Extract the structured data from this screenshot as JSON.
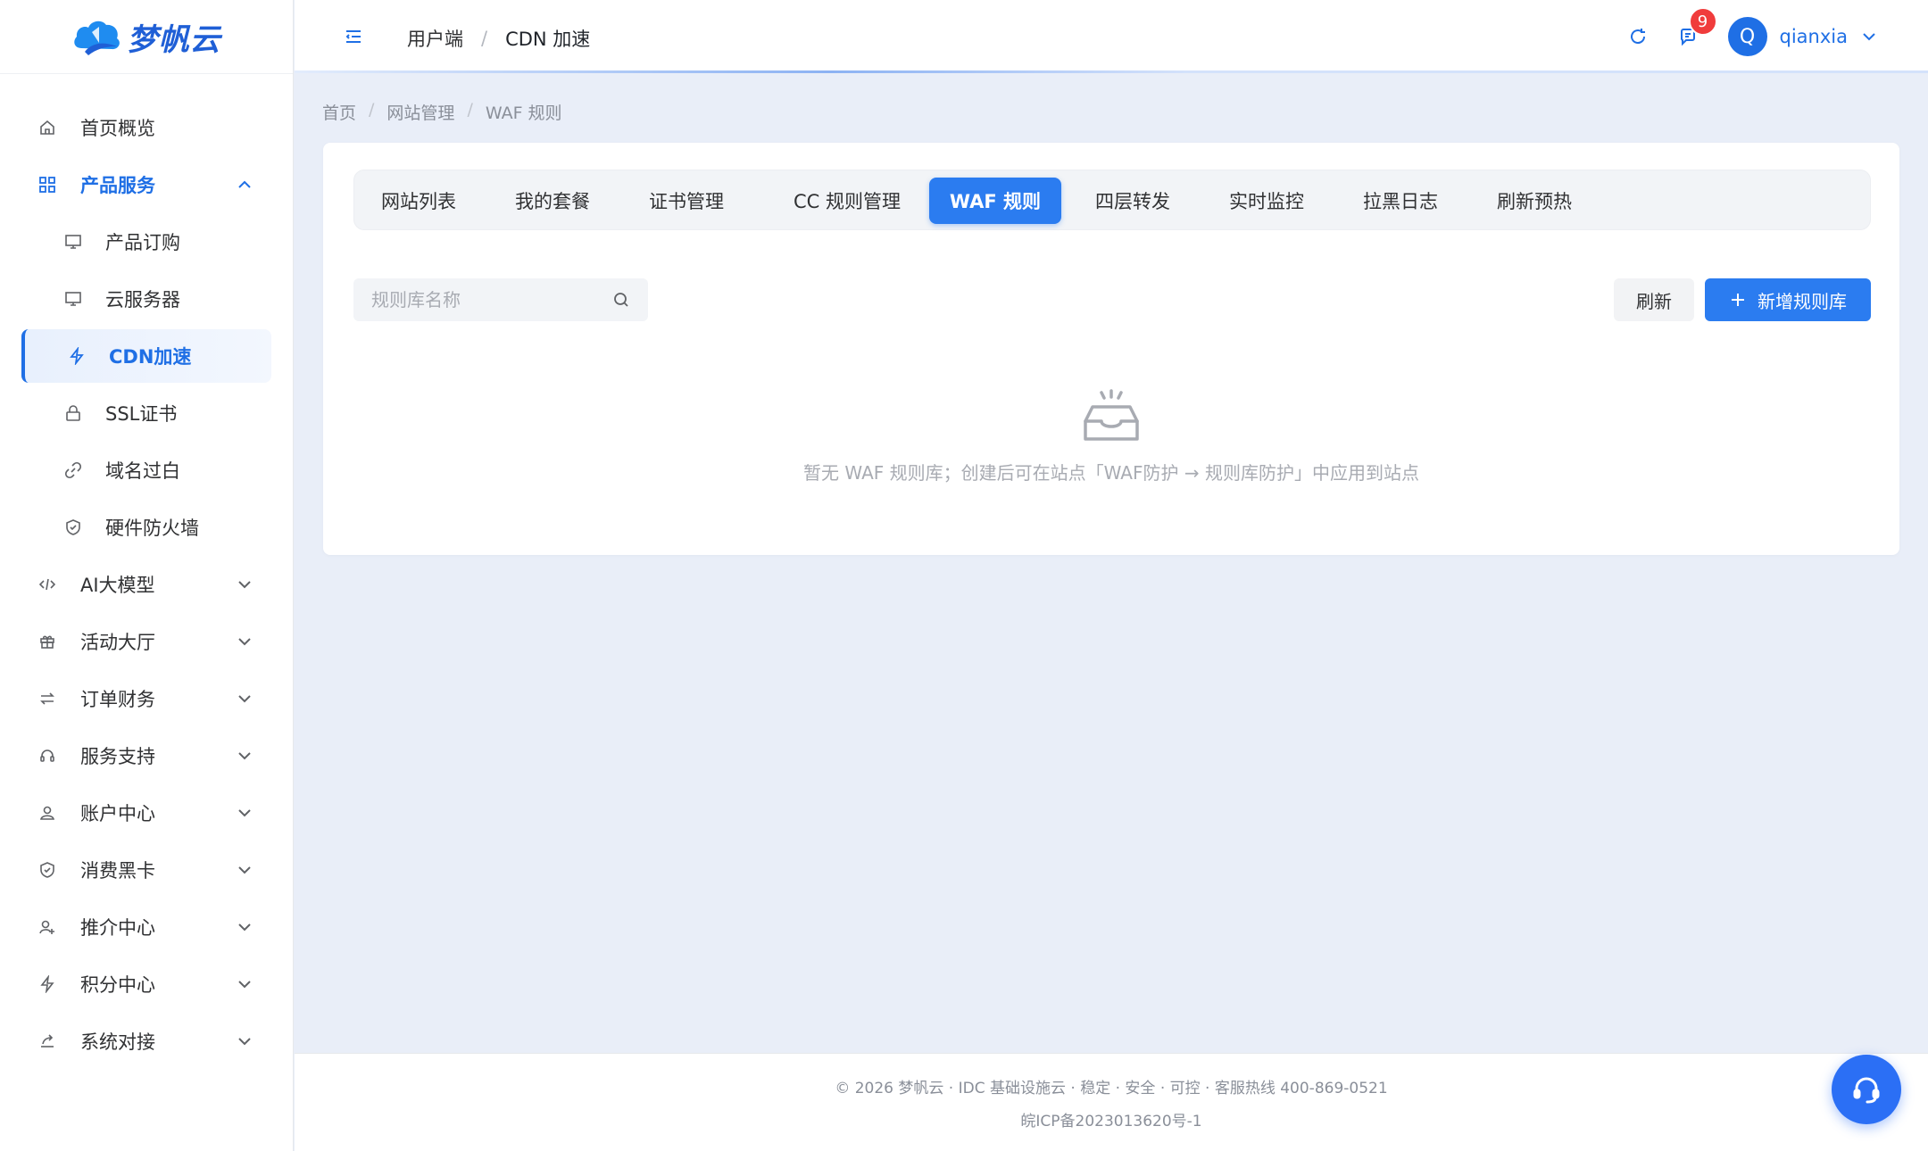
{
  "brand": {
    "name": "梦帆云",
    "color": "#1f5fd6"
  },
  "sidebar": {
    "items": [
      {
        "label": "首页概览",
        "icon": "home-icon"
      },
      {
        "label": "产品服务",
        "icon": "grid-icon",
        "expanded": true,
        "children": [
          {
            "label": "产品订购",
            "icon": "monitor-icon"
          },
          {
            "label": "云服务器",
            "icon": "monitor-icon"
          },
          {
            "label": "CDN加速",
            "icon": "bolt-icon",
            "active": true
          },
          {
            "label": "SSL证书",
            "icon": "lock-icon"
          },
          {
            "label": "域名过白",
            "icon": "link-icon"
          },
          {
            "label": "硬件防火墙",
            "icon": "shield-icon"
          }
        ]
      },
      {
        "label": "AI大模型",
        "icon": "code-icon"
      },
      {
        "label": "活动大厅",
        "icon": "gift-icon"
      },
      {
        "label": "订单财务",
        "icon": "swap-icon"
      },
      {
        "label": "服务支持",
        "icon": "headset-icon"
      },
      {
        "label": "账户中心",
        "icon": "user-icon"
      },
      {
        "label": "消费黑卡",
        "icon": "shield-icon"
      },
      {
        "label": "推介中心",
        "icon": "user-plus-icon"
      },
      {
        "label": "积分中心",
        "icon": "bolt-icon"
      },
      {
        "label": "系统对接",
        "icon": "share-icon"
      }
    ]
  },
  "header": {
    "breadcrumb": [
      "用户端",
      "CDN 加速"
    ],
    "notification_count": "9",
    "avatar_letter": "Q",
    "username": "qianxia"
  },
  "page": {
    "breadcrumb": [
      "首页",
      "网站管理",
      "WAF 规则"
    ],
    "tabs": [
      "网站列表",
      "我的套餐",
      "证书管理",
      "CC 规则管理",
      "WAF 规则",
      "四层转发",
      "实时监控",
      "拉黑日志",
      "刷新预热"
    ],
    "active_tab": "WAF 规则",
    "search_placeholder": "规则库名称",
    "refresh_label": "刷新",
    "add_label": "新增规则库",
    "empty_text": "暂无 WAF 规则库；创建后可在站点「WAF防护 → 规则库防护」中应用到站点"
  },
  "footer": {
    "line1": "© 2026 梦帆云 · IDC 基础设施云 · 稳定 · 安全 · 可控 · 客服热线 400-869-0521",
    "line2": "皖ICP备2023013620号-1"
  },
  "colors": {
    "accent": "#2b7cf0",
    "active_text": "#1f6fe5",
    "badge": "#f03c3c",
    "background": "#e9eef8"
  }
}
